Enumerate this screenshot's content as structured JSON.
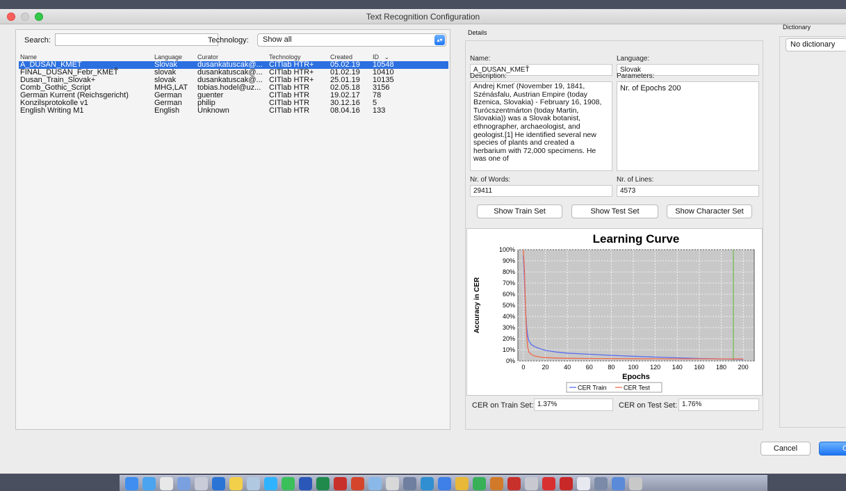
{
  "window": {
    "title": "Text Recognition Configuration"
  },
  "search": {
    "label": "Search:",
    "value": ""
  },
  "technology_filter": {
    "label": "Technology:",
    "selected": "Show all"
  },
  "table": {
    "columns": [
      "Name",
      "Language",
      "Curator",
      "Technology",
      "Created",
      "ID"
    ],
    "sort_indicator": "⌄",
    "rows": [
      {
        "name": "A_DUSAN_KMEŤ",
        "language": "Slovak",
        "curator": "dusankatuscak@...",
        "technology": "CITlab HTR+",
        "created": "05.02.19",
        "id": "10548",
        "selected": true
      },
      {
        "name": "FINAL_DUSAN_Febr_KMEŤ",
        "language": "slovak",
        "curator": "dusankatuscak@...",
        "technology": "CITlab HTR+",
        "created": "01.02.19",
        "id": "10410"
      },
      {
        "name": "Dusan_Train_Slovak+",
        "language": "slovak",
        "curator": "dusankatuscak@...",
        "technology": "CITlab HTR+",
        "created": "25.01.19",
        "id": "10135"
      },
      {
        "name": "Comb_Gothic_Script",
        "language": "MHG,LAT",
        "curator": "tobias.hodel@uz...",
        "technology": "CITlab HTR",
        "created": "02.05.18",
        "id": "3156"
      },
      {
        "name": "German Kurrent (Reichsgericht)",
        "language": "German",
        "curator": "guenter",
        "technology": "CITlab HTR",
        "created": "19.02.17",
        "id": "78"
      },
      {
        "name": "Konzilsprotokolle v1",
        "language": "German",
        "curator": "philip",
        "technology": "CITlab HTR",
        "created": "30.12.16",
        "id": "5"
      },
      {
        "name": "English Writing M1",
        "language": "English",
        "curator": "Unknown",
        "technology": "CITlab HTR",
        "created": "08.04.16",
        "id": "133"
      }
    ]
  },
  "details": {
    "section_label": "Details",
    "name_label": "Name:",
    "name_value": "A_DUSAN_KMEŤ",
    "language_label": "Language:",
    "language_value": "Slovak",
    "description_label": "Description:",
    "description_value": "Andrej Kmeť (November 19, 1841, Szénásfalu, Austrian Empire (today Bzenica, Slovakia) - February 16, 1908, Turócszentmárton (today Martin, Slovakia)) was a Slovak botanist, ethnographer, archaeologist, and geologist.[1] He identified several new species of plants and created a herbarium with 72,000 specimens. He was one of",
    "parameters_label": "Parameters:",
    "parameters_value": "Nr. of Epochs  200",
    "words_label": "Nr. of Words:",
    "words_value": "29411",
    "lines_label": "Nr. of Lines:",
    "lines_value": "4573",
    "btn_train": "Show Train Set",
    "btn_test": "Show Test Set",
    "btn_charset": "Show Character Set",
    "cer_train_label": "CER on Train Set:",
    "cer_train_value": "1.37%",
    "cer_test_label": "CER on Test Set:",
    "cer_test_value": "1.76%"
  },
  "chart_data": {
    "type": "line",
    "title": "Learning Curve",
    "xlabel": "Epochs",
    "ylabel": "Accuracy in CER",
    "xlim": [
      -5,
      210
    ],
    "ylim": [
      0,
      100
    ],
    "xticks": [
      0,
      20,
      40,
      60,
      80,
      100,
      120,
      140,
      160,
      180,
      200
    ],
    "yticks": [
      "0%",
      "10%",
      "20%",
      "30%",
      "40%",
      "50%",
      "60%",
      "70%",
      "80%",
      "90%",
      "100%"
    ],
    "grid": true,
    "legend": "bottom",
    "series": [
      {
        "name": "CER Train",
        "color": "#5b6cf0",
        "x": [
          0,
          1,
          2,
          3,
          4,
          5,
          7,
          10,
          15,
          20,
          30,
          40,
          60,
          80,
          100,
          120,
          140,
          160,
          180,
          200
        ],
        "y": [
          95,
          70,
          45,
          30,
          22,
          18,
          15,
          13,
          11,
          9.5,
          8,
          7,
          6,
          5,
          4.2,
          3.5,
          2.8,
          2.2,
          1.8,
          1.37
        ]
      },
      {
        "name": "CER Test",
        "color": "#ef6a4c",
        "x": [
          0,
          1,
          2,
          3,
          4,
          5,
          7,
          10,
          15,
          20,
          30,
          40,
          60,
          80,
          100,
          120,
          140,
          160,
          180,
          200
        ],
        "y": [
          100,
          80,
          45,
          22,
          12,
          8,
          6,
          4.5,
          3.5,
          3,
          2.6,
          2.4,
          2.2,
          2.1,
          2,
          1.95,
          1.9,
          1.85,
          1.8,
          1.76
        ]
      }
    ],
    "vline": {
      "x": 191,
      "color": "#6dbd4b"
    }
  },
  "dictionary": {
    "label": "Dictionary",
    "selected": "No dictionary"
  },
  "footer": {
    "cancel": "Cancel",
    "ok": "OK"
  },
  "dock": {
    "icons": [
      "finder-icon",
      "safari-icon",
      "transkribus-icon",
      "preview-icon",
      "launchpad-icon",
      "outlook-icon",
      "notes-icon",
      "photos-icon",
      "messages-icon",
      "facetime-icon",
      "word-icon",
      "excel-icon",
      "filezilla-icon",
      "powerpoint-icon",
      "screen-sharing-icon",
      "scanner-icon",
      "disk-icon",
      "stickies-icon",
      "appstore-icon",
      "chrome-icon",
      "vpn-icon",
      "squirrel-icon",
      "acrobat-icon",
      "help-icon",
      "red-app-icon",
      "acrobat-reader-icon",
      "textedit-icon",
      "archive-icon",
      "downloads-icon",
      "trash-icon"
    ],
    "colors": [
      "#3f8ef0",
      "#4aa4f0",
      "#e8e8e8",
      "#7aa0e0",
      "#c9ccd8",
      "#2a74d6",
      "#f2d04a",
      "#b0c8e0",
      "#2fb3ff",
      "#3bbf5a",
      "#2b57b8",
      "#1f8a4c",
      "#c8302b",
      "#d3462b",
      "#8ab8e8",
      "#d8d8d8",
      "#6f7f9f",
      "#2f8fd0",
      "#3f80e8",
      "#e8b838",
      "#38b058",
      "#d07a2a",
      "#c8302b",
      "#c8c8d0",
      "#d83030",
      "#c82828",
      "#e8e8f0",
      "#7a8aa8",
      "#5a8ad8",
      "#c8c8c8"
    ]
  }
}
